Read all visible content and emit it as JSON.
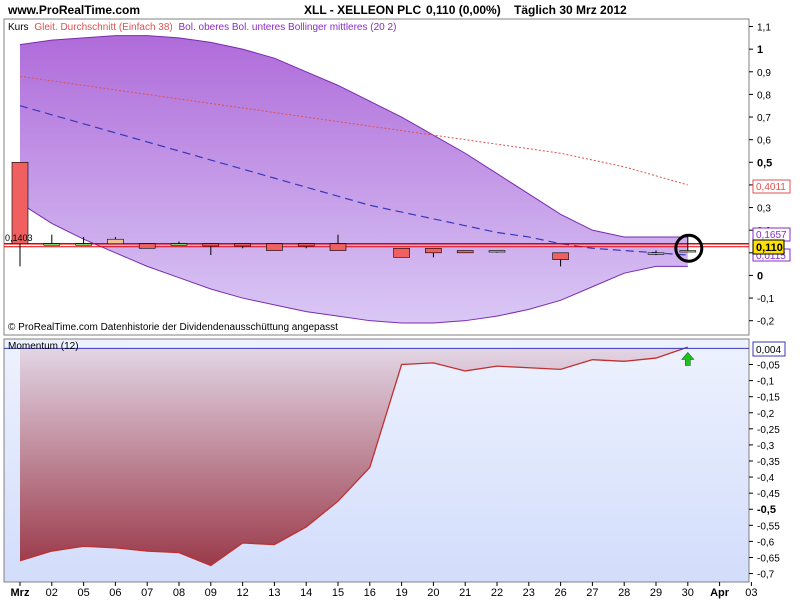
{
  "header": {
    "site": "www.ProRealTime.com",
    "instrument": "XLL - XELLEON PLC",
    "quote": "0,110 (0,00%)",
    "period": "Täglich  30 Mrz 2012"
  },
  "price_panel": {
    "legend_kurs": "Kurs",
    "legend_sma": "Gleit. Durchschnitt (Einfach 38)",
    "legend_boll": "Bol. oberes Bol. unteres Bollinger mittleres (20 2)",
    "footer": "© ProRealTime.com  Datenhistorie der Dividendenausschüttung angepasst",
    "left_label": "0,1403",
    "badges": {
      "sma": "0,4011",
      "boll_upper": "0,1657",
      "close": "0,110",
      "boll_lower": "0,0115"
    }
  },
  "momentum_panel": {
    "legend": "Momentum (12)",
    "badge": "0,004"
  },
  "colors": {
    "band_fill": "#a65bd6",
    "band_line": "#7a2bb0",
    "sma": "#e05050",
    "boll_mid": "#3838b8",
    "hline": "#e00000",
    "candle_up": "#f0c090",
    "candle_down": "#f06060",
    "candle_neutral": "#a0e070",
    "momentum_line": "#c03030",
    "arrow": "#20c020"
  },
  "chart_data": [
    {
      "type": "candlestick",
      "title": "XLL - XELLEON PLC",
      "x": [
        "Mrz",
        "02",
        "05",
        "06",
        "07",
        "08",
        "09",
        "12",
        "13",
        "14",
        "15",
        "16",
        "19",
        "20",
        "21",
        "22",
        "23",
        "26",
        "27",
        "28",
        "29",
        "30"
      ],
      "ohlc": [
        [
          0.5,
          0.5,
          0.04,
          0.14
        ],
        [
          0.14,
          0.18,
          0.14,
          0.14
        ],
        [
          0.14,
          0.17,
          0.14,
          0.14
        ],
        [
          0.14,
          0.17,
          0.14,
          0.16
        ],
        [
          0.14,
          0.14,
          0.12,
          0.12
        ],
        [
          0.14,
          0.15,
          0.14,
          0.14
        ],
        [
          0.14,
          0.14,
          0.09,
          0.13
        ],
        [
          0.14,
          0.14,
          0.12,
          0.13
        ],
        [
          0.14,
          0.14,
          0.11,
          0.11
        ],
        [
          0.14,
          0.14,
          0.12,
          0.13
        ],
        [
          0.14,
          0.18,
          0.12,
          0.11
        ],
        null,
        [
          0.12,
          0.12,
          0.08,
          0.08
        ],
        [
          0.12,
          0.12,
          0.08,
          0.1
        ],
        [
          0.11,
          0.11,
          0.1,
          0.1
        ],
        [
          0.11,
          0.11,
          0.1,
          0.11
        ],
        null,
        [
          0.1,
          0.1,
          0.04,
          0.07
        ],
        null,
        null,
        [
          0.1,
          0.11,
          0.09,
          0.1
        ],
        [
          0.11,
          0.17,
          0.11,
          0.11
        ]
      ],
      "ylim": [
        -0.25,
        1.12
      ],
      "y_ticks": [
        "1,1",
        "1",
        "0,9",
        "0,8",
        "0,7",
        "0,6",
        "0,5",
        "0,4",
        "0,3",
        "0,2",
        "0,1",
        "0",
        "-0,1",
        "-0,2"
      ],
      "x_tick_labels": [
        "Mrz",
        "02",
        "05",
        "06",
        "07",
        "08",
        "09",
        "12",
        "13",
        "14",
        "15",
        "16",
        "19",
        "20",
        "21",
        "22",
        "23",
        "26",
        "27",
        "28",
        "29",
        "30",
        "Apr",
        "03"
      ],
      "overlays": [
        {
          "name": "Gleit. Durchschnitt (Einfach 38)",
          "values": [
            0.88,
            0.86,
            0.84,
            0.82,
            0.8,
            0.78,
            0.76,
            0.74,
            0.72,
            0.7,
            0.68,
            0.66,
            0.64,
            0.62,
            0.6,
            0.58,
            0.56,
            0.54,
            0.51,
            0.48,
            0.44,
            0.4
          ]
        },
        {
          "name": "Bollinger mittleres",
          "values": [
            0.75,
            0.71,
            0.67,
            0.63,
            0.59,
            0.55,
            0.51,
            0.47,
            0.43,
            0.39,
            0.35,
            0.31,
            0.28,
            0.25,
            0.22,
            0.19,
            0.17,
            0.14,
            0.12,
            0.11,
            0.1,
            0.09
          ]
        },
        {
          "name": "Bol. oberes",
          "values": [
            1.02,
            1.04,
            1.05,
            1.06,
            1.06,
            1.05,
            1.03,
            1.0,
            0.96,
            0.9,
            0.84,
            0.77,
            0.7,
            0.62,
            0.54,
            0.45,
            0.36,
            0.27,
            0.2,
            0.17,
            0.17,
            0.17
          ]
        },
        {
          "name": "Bol. unteres",
          "values": [
            0.32,
            0.23,
            0.16,
            0.1,
            0.04,
            -0.01,
            -0.06,
            -0.1,
            -0.13,
            -0.16,
            -0.18,
            -0.2,
            -0.21,
            -0.21,
            -0.2,
            -0.18,
            -0.15,
            -0.11,
            -0.05,
            0.01,
            0.04,
            0.04
          ]
        }
      ]
    },
    {
      "type": "area",
      "title": "Momentum (12)",
      "x": [
        "Mrz",
        "02",
        "05",
        "06",
        "07",
        "08",
        "09",
        "12",
        "13",
        "14",
        "15",
        "16",
        "19",
        "20",
        "21",
        "22",
        "23",
        "26",
        "27",
        "28",
        "29",
        "30"
      ],
      "values": [
        -0.66,
        -0.63,
        -0.615,
        -0.62,
        -0.63,
        -0.635,
        -0.675,
        -0.605,
        -0.61,
        -0.555,
        -0.475,
        -0.37,
        -0.05,
        -0.045,
        -0.07,
        -0.055,
        -0.06,
        -0.065,
        -0.035,
        -0.04,
        -0.03,
        0.004
      ],
      "ylim": [
        -0.72,
        0.02
      ],
      "y_ticks": [
        "-0,05",
        "-0,1",
        "-0,15",
        "-0,2",
        "-0,25",
        "-0,3",
        "-0,35",
        "-0,4",
        "-0,45",
        "-0,5",
        "-0,55",
        "-0,6",
        "-0,65",
        "-0,7"
      ]
    }
  ]
}
